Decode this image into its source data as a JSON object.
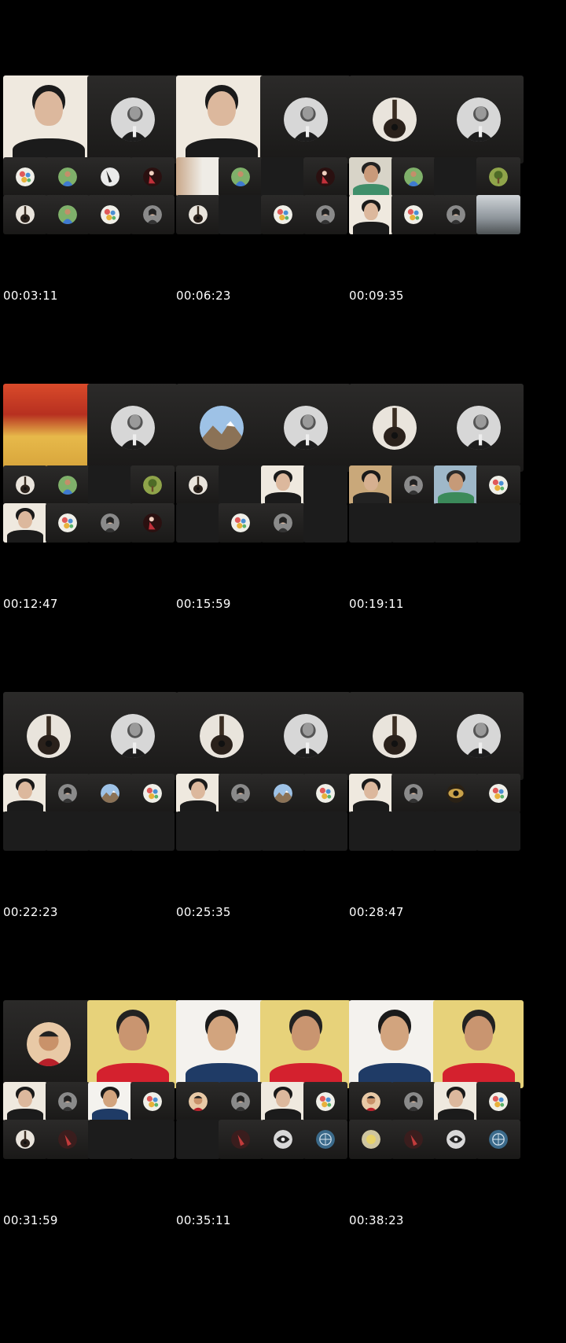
{
  "frames": [
    {
      "timestamp": "00:03:11"
    },
    {
      "timestamp": "00:06:23"
    },
    {
      "timestamp": "00:09:35"
    },
    {
      "timestamp": "00:12:47"
    },
    {
      "timestamp": "00:15:59"
    },
    {
      "timestamp": "00:19:11"
    },
    {
      "timestamp": "00:22:23"
    },
    {
      "timestamp": "00:25:35"
    },
    {
      "timestamp": "00:28:47"
    },
    {
      "timestamp": "00:31:59"
    },
    {
      "timestamp": "00:35:11"
    },
    {
      "timestamp": "00:38:23"
    }
  ],
  "avatar_icons": {
    "guitar": "guitar-avatar-icon",
    "man_portrait": "man-portrait-avatar-icon",
    "colorful": "colorful-avatar-icon",
    "person_blue": "person-blue-avatar-icon",
    "mountain": "mountain-avatar-icon",
    "tree": "tree-avatar-icon",
    "eye": "eye-avatar-icon",
    "woman": "woman-avatar-icon"
  },
  "colors": {
    "background": "#000000",
    "tile": "#1c1c1c",
    "timestamp_text": "#ffffff"
  }
}
